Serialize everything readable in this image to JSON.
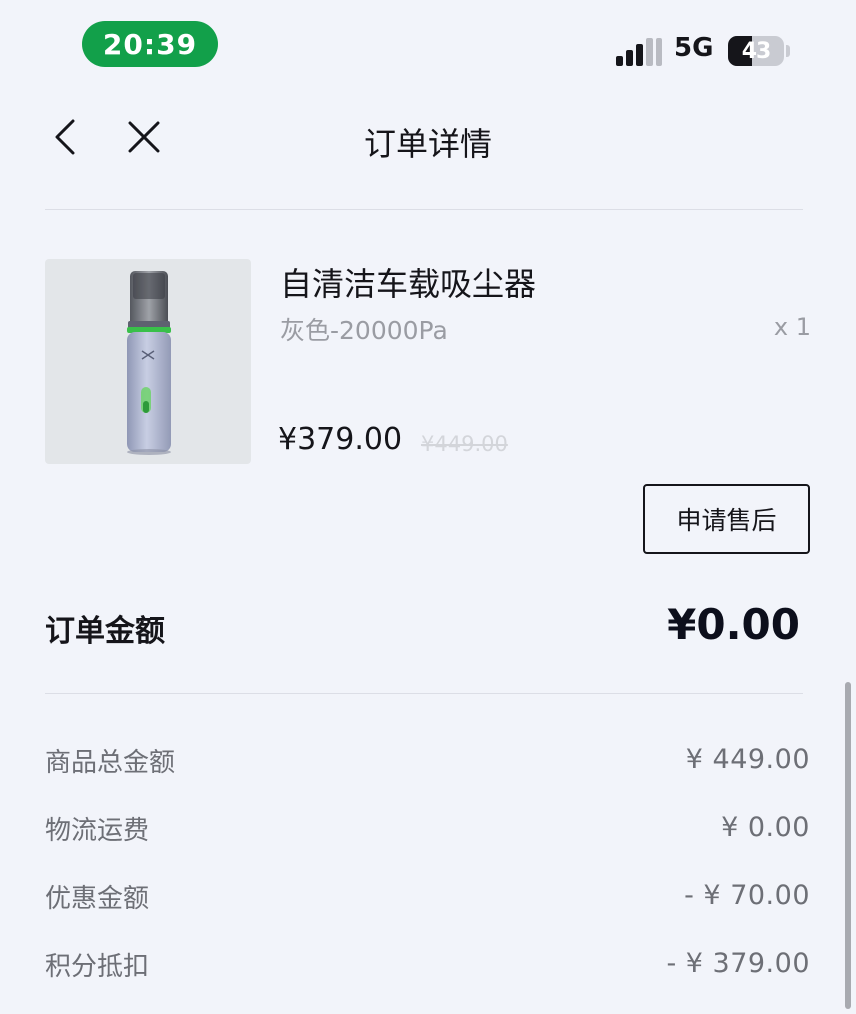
{
  "status_bar": {
    "time": "20:39",
    "network": "5G",
    "battery": "43",
    "battery_level": 0.43,
    "signal_icon": "cellular-signal-icon",
    "battery_icon": "battery-icon",
    "time_pill_color": "#12a04a"
  },
  "nav": {
    "title": "订单详情",
    "back_icon": "chevron-left-icon",
    "close_icon": "close-icon"
  },
  "product": {
    "name": "自清洁车载吸尘器",
    "variant": "灰色-20000Pa",
    "quantity": "x 1",
    "price": "¥379.00",
    "original_price": "¥449.00",
    "after_sale_label": "申请售后"
  },
  "order_total": {
    "label": "订单金额",
    "value": "¥0.00"
  },
  "summary": [
    {
      "label": "商品总金额",
      "value": "¥ 449.00"
    },
    {
      "label": "物流运费",
      "value": "¥ 0.00"
    },
    {
      "label": "优惠金额",
      "value": "- ¥ 70.00"
    },
    {
      "label": "积分抵扣",
      "value": "- ¥ 379.00"
    }
  ]
}
